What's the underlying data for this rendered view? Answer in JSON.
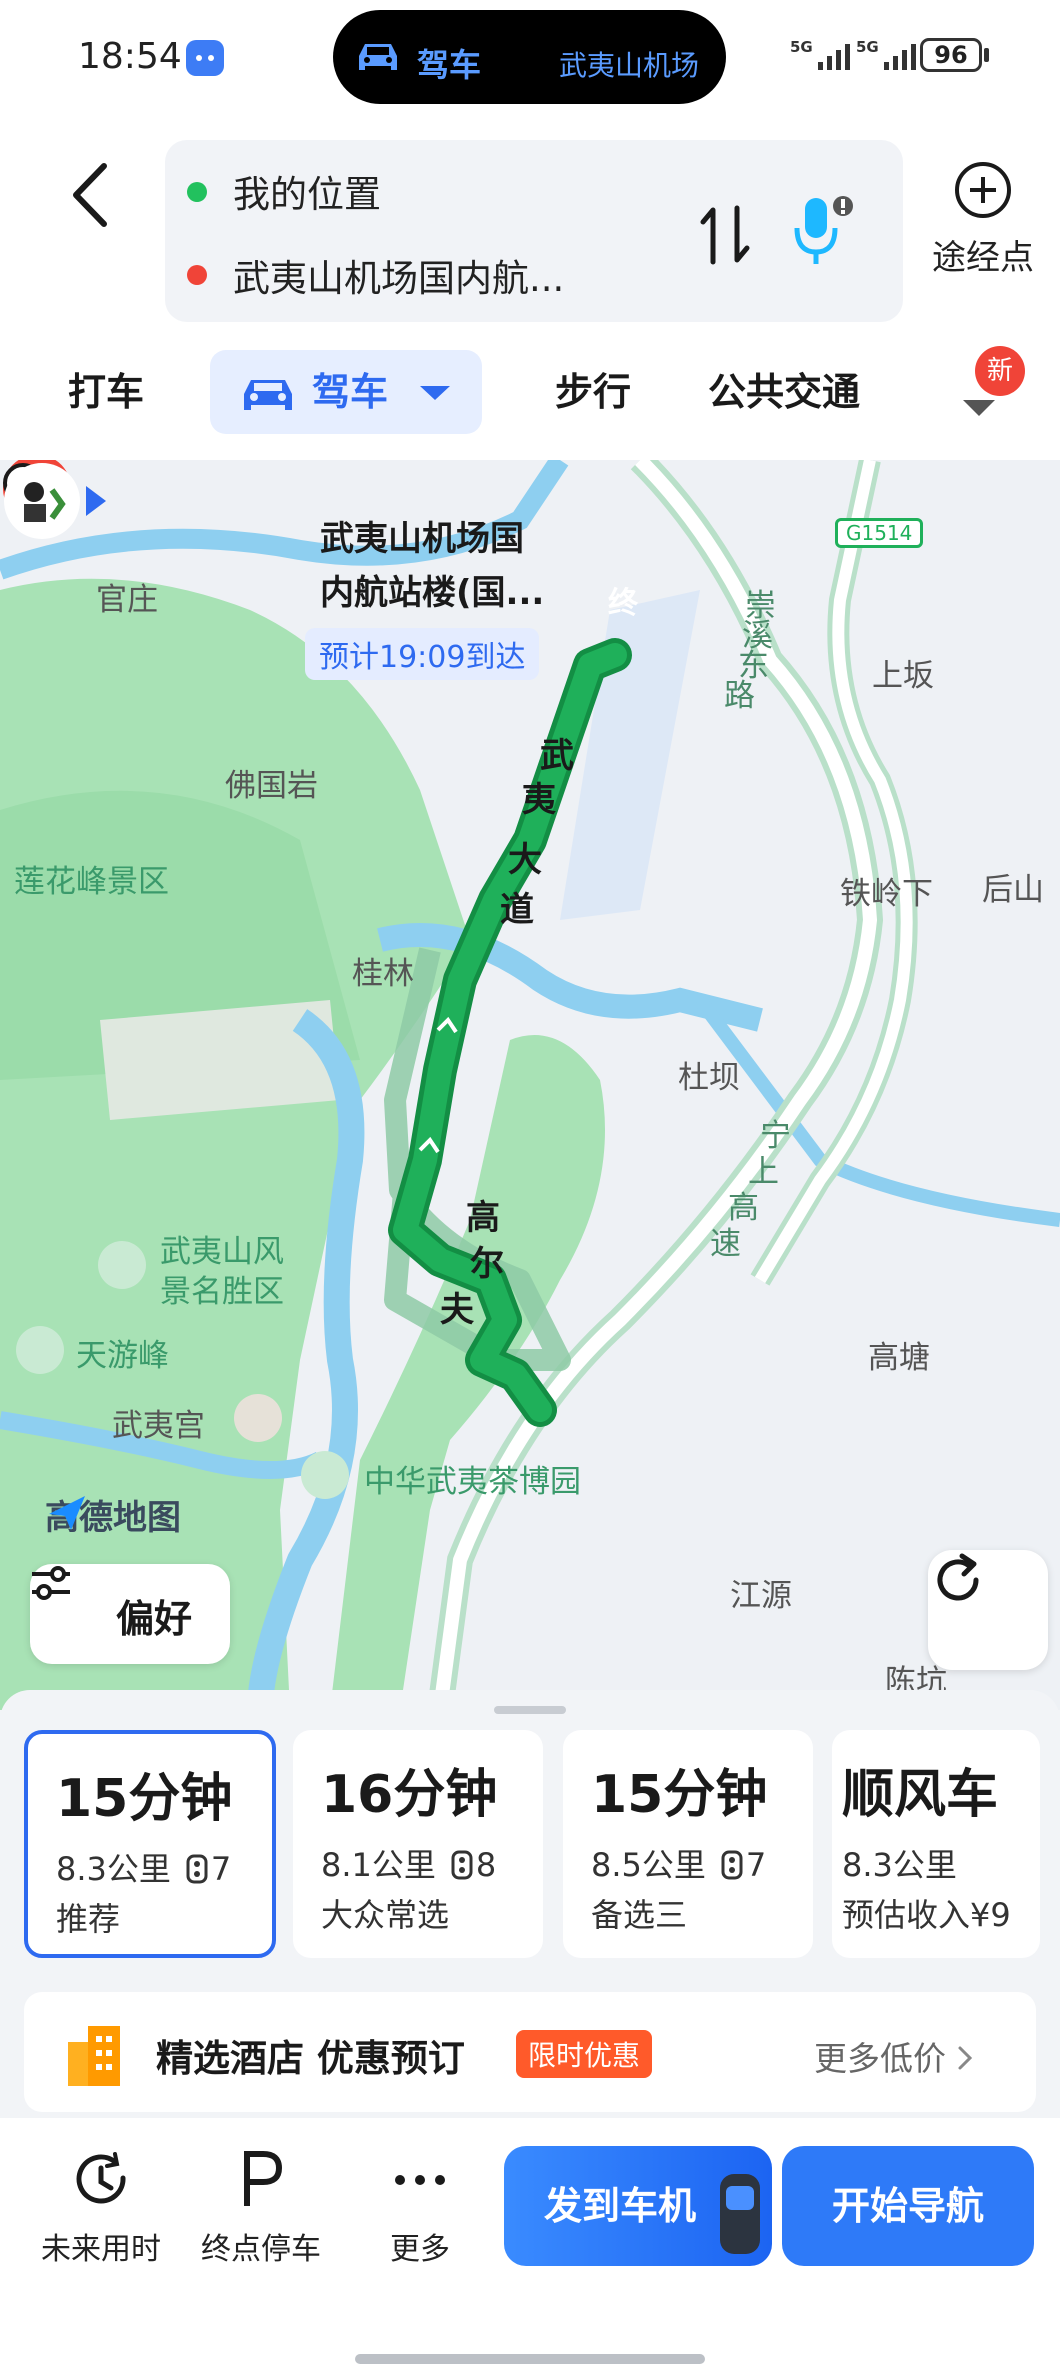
{
  "status_bar": {
    "time": "18:54",
    "island_mode": "驾车",
    "island_destination": "武夷山机场",
    "signal_1": "5G",
    "signal_2": "5G",
    "battery": "96"
  },
  "route": {
    "origin": "我的位置",
    "destination": "武夷山机场国内航...",
    "waypoint_label": "途经点"
  },
  "modes": {
    "taxi": "打车",
    "drive": "驾车",
    "walk": "步行",
    "transit": "公共交通",
    "new_badge": "新"
  },
  "map": {
    "dest_name_line1": "武夷山机场国",
    "dest_name_line2": "内航站楼(国...",
    "end_marker": "终",
    "eta": "预计19:09到达",
    "highway_badge": "G1514",
    "labels": {
      "guanzhuang": "官庄",
      "chongxi_road_1": "崇",
      "chongxi_road_2": "溪",
      "chongxi_road_3": "东",
      "chongxi_road_4": "路",
      "shangban": "上坂",
      "foguoyan": "佛国岩",
      "lianhuafeng": "莲花峰景区",
      "wuyi_road_1": "武",
      "wuyi_road_2": "夷",
      "wuyi_road_3": "大",
      "wuyi_road_4": "道",
      "tielingxia": "铁岭下",
      "houshan": "后山",
      "guilin": "桂林",
      "duba": "杜坝",
      "ningshang_1": "宁",
      "ningshang_2": "上",
      "ningshang_3": "高",
      "ningshang_4": "速",
      "scenic_1": "武夷山风",
      "scenic_2": "景名胜区",
      "golf_1": "高",
      "golf_2": "尔",
      "golf_3": "夫",
      "tianyoufeng": "天游峰",
      "gaotang": "高塘",
      "wuyigong": "武夷宫",
      "tea_museum": "中华武夷茶博园",
      "jiangyuan": "江源",
      "chenkeng": "陈坑"
    },
    "logo": "高德地图",
    "preference": "偏好"
  },
  "routes": [
    {
      "time": "15分钟",
      "distance": "8.3公里",
      "lights": "7",
      "tag": "推荐",
      "selected": true
    },
    {
      "time": "16分钟",
      "distance": "8.1公里",
      "lights": "8",
      "tag": "大众常选",
      "selected": false
    },
    {
      "time": "15分钟",
      "distance": "8.5公里",
      "lights": "7",
      "tag": "备选三",
      "selected": false
    },
    {
      "time": "顺风车",
      "distance": "8.3公里",
      "lights": "",
      "tag": "预估收入¥9",
      "selected": false
    }
  ],
  "hotel": {
    "title": "精选酒店 优惠预订",
    "badge": "限时优惠",
    "more": "更多低价"
  },
  "actions": {
    "future": "未来用时",
    "parking": "终点停车",
    "more": "更多",
    "send_to_car": "发到车机",
    "start_nav": "开始导航"
  },
  "colors": {
    "accent": "#2e6af0",
    "route_green": "#1fb05a",
    "dest_red": "#f04438"
  }
}
